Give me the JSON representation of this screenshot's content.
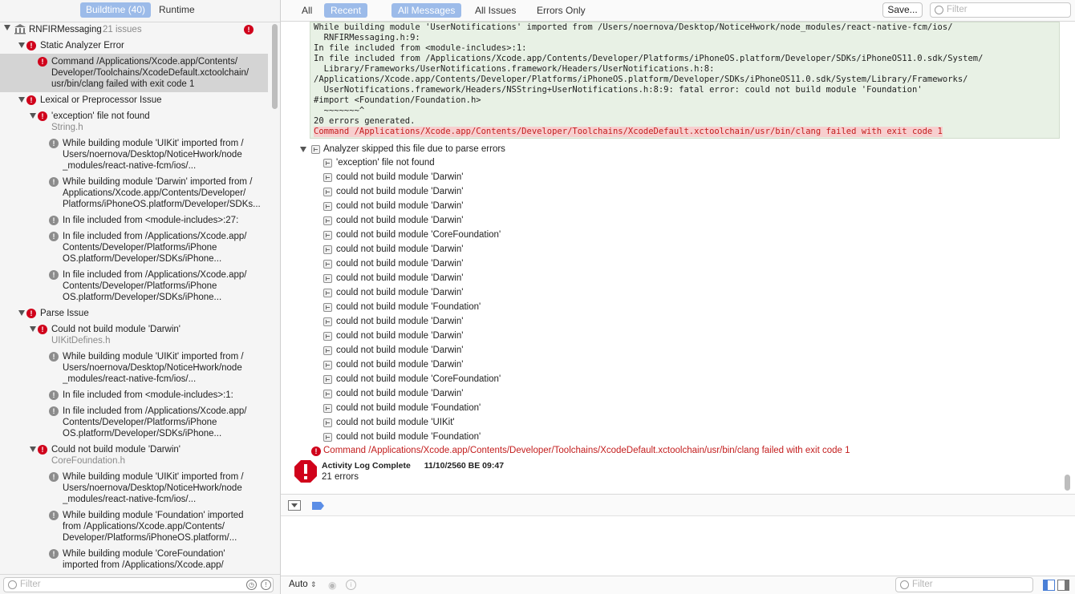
{
  "left": {
    "tabs": [
      {
        "label": "Buildtime (40)",
        "active": true
      },
      {
        "label": "Runtime",
        "active": false
      }
    ],
    "target": {
      "name": "RNFIRMessaging",
      "count": "21 issues"
    },
    "issues": [
      {
        "kind": "group",
        "label": "Static Analyzer Error"
      },
      {
        "kind": "error-selected",
        "label": "Command /Applications/Xcode.app/Contents/\nDeveloper/Toolchains/XcodeDefault.xctoolchain/\nusr/bin/clang failed with exit code 1"
      },
      {
        "kind": "group",
        "label": "Lexical or Preprocessor Issue"
      },
      {
        "kind": "error",
        "label": "'exception' file not found",
        "sub": "String.h"
      },
      {
        "kind": "note",
        "label": "While building module 'UIKit' imported from /\nUsers/noernova/Desktop/NoticeHwork/node\n_modules/react-native-fcm/ios/..."
      },
      {
        "kind": "note",
        "label": "While building module 'Darwin' imported from /\nApplications/Xcode.app/Contents/Developer/\nPlatforms/iPhoneOS.platform/Developer/SDKs..."
      },
      {
        "kind": "note",
        "label": "In file included from <module-includes>:27:"
      },
      {
        "kind": "note",
        "label": "In file included from /Applications/Xcode.app/\nContents/Developer/Platforms/iPhone\nOS.platform/Developer/SDKs/iPhone..."
      },
      {
        "kind": "note",
        "label": "In file included from /Applications/Xcode.app/\nContents/Developer/Platforms/iPhone\nOS.platform/Developer/SDKs/iPhone..."
      },
      {
        "kind": "group",
        "label": "Parse Issue"
      },
      {
        "kind": "error",
        "label": "Could not build module 'Darwin'",
        "sub": "UIKitDefines.h"
      },
      {
        "kind": "note",
        "label": "While building module 'UIKit' imported from /\nUsers/noernova/Desktop/NoticeHwork/node\n_modules/react-native-fcm/ios/..."
      },
      {
        "kind": "note",
        "label": "In file included from <module-includes>:1:"
      },
      {
        "kind": "note",
        "label": "In file included from /Applications/Xcode.app/\nContents/Developer/Platforms/iPhone\nOS.platform/Developer/SDKs/iPhone..."
      },
      {
        "kind": "error",
        "label": "Could not build module 'Darwin'",
        "sub": "CoreFoundation.h"
      },
      {
        "kind": "note",
        "label": "While building module 'UIKit' imported from /\nUsers/noernova/Desktop/NoticeHwork/node\n_modules/react-native-fcm/ios/..."
      },
      {
        "kind": "note",
        "label": "While building module 'Foundation' imported\nfrom /Applications/Xcode.app/Contents/\nDeveloper/Platforms/iPhoneOS.platform/..."
      },
      {
        "kind": "note",
        "label": "While building module 'CoreFoundation'\nimported from /Applications/Xcode.app/"
      }
    ],
    "filter_placeholder": "Filter"
  },
  "toolbar": {
    "scope": [
      {
        "label": "All",
        "active": false
      },
      {
        "label": "Recent",
        "active": true
      }
    ],
    "kinds": [
      {
        "label": "All Messages",
        "active": true
      },
      {
        "label": "All Issues",
        "active": false
      },
      {
        "label": "Errors Only",
        "active": false
      }
    ],
    "save_label": "Save...",
    "filter_placeholder": "Filter"
  },
  "log": {
    "code_lines": [
      "While building module 'UserNotifications' imported from /Users/noernova/Desktop/NoticeHwork/node_modules/react-native-fcm/ios/",
      "  RNFIRMessaging.h:9:",
      "In file included from <module-includes>:1:",
      "In file included from /Applications/Xcode.app/Contents/Developer/Platforms/iPhoneOS.platform/Developer/SDKs/iPhoneOS11.0.sdk/System/",
      "  Library/Frameworks/UserNotifications.framework/Headers/UserNotifications.h:8:",
      "/Applications/Xcode.app/Contents/Developer/Platforms/iPhoneOS.platform/Developer/SDKs/iPhoneOS11.0.sdk/System/Library/Frameworks/",
      "  UserNotifications.framework/Headers/NSString+UserNotifications.h:8:9: fatal error: could not build module 'Foundation'",
      "#import <Foundation/Foundation.h>",
      "  ~~~~~~~^",
      "20 errors generated."
    ],
    "code_error_line": "Command /Applications/Xcode.app/Contents/Developer/Toolchains/XcodeDefault.xctoolchain/usr/bin/clang failed with exit code 1",
    "analyzer_header": "Analyzer skipped this file due to parse errors",
    "analyzer_items": [
      "'exception' file not found",
      "could not build module 'Darwin'",
      "could not build module 'Darwin'",
      "could not build module 'Darwin'",
      "could not build module 'Darwin'",
      "could not build module 'CoreFoundation'",
      "could not build module 'Darwin'",
      "could not build module 'Darwin'",
      "could not build module 'Darwin'",
      "could not build module 'Darwin'",
      "could not build module 'Foundation'",
      "could not build module 'Darwin'",
      "could not build module 'Darwin'",
      "could not build module 'Darwin'",
      "could not build module 'Darwin'",
      "could not build module 'CoreFoundation'",
      "could not build module 'Darwin'",
      "could not build module 'Foundation'",
      "could not build module 'UIKit'",
      "could not build module 'Foundation'"
    ],
    "command_error": "Command /Applications/Xcode.app/Contents/Developer/Toolchains/XcodeDefault.xctoolchain/usr/bin/clang failed with exit code 1",
    "complete_title": "Activity Log Complete",
    "complete_time": "11/10/2560 BE 09:47",
    "complete_errors": "21 errors"
  },
  "bottom": {
    "auto_label": "Auto",
    "filter_placeholder": "Filter"
  },
  "colors": {
    "accent": "#9cbbe9",
    "error": "#d0021b",
    "error_text": "#c31d1d",
    "code_bg": "#e8f1e5",
    "error_bg": "#f7cfcf"
  }
}
